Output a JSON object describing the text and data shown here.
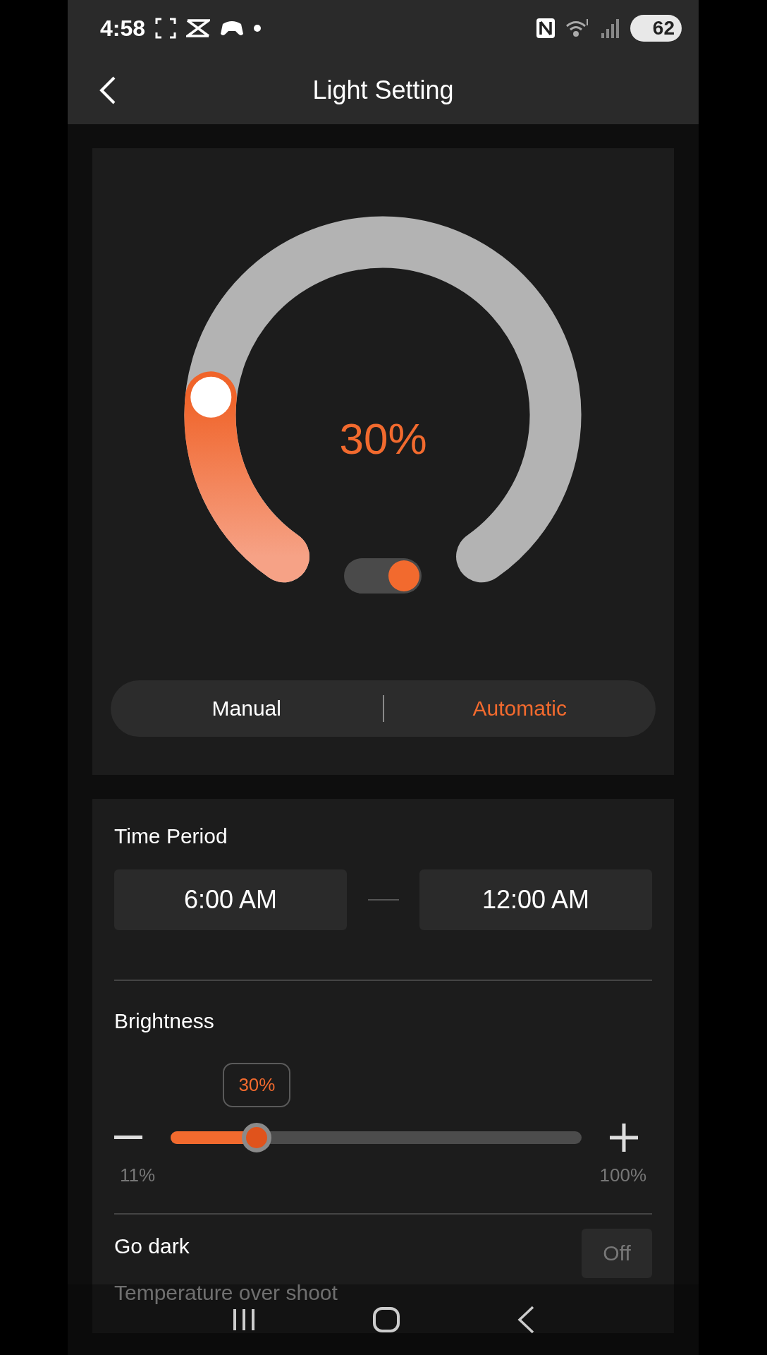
{
  "status_bar": {
    "time": "4:58",
    "battery": "62"
  },
  "header": {
    "title": "Light Setting"
  },
  "dial": {
    "value": "30%",
    "level": 0.21,
    "switch_on": true
  },
  "mode_tabs": [
    {
      "label": "Manual",
      "selected": false
    },
    {
      "label": "Automatic",
      "selected": true
    }
  ],
  "time_period": {
    "label": "Time Period",
    "start": "6:00 AM",
    "end": "12:00 AM"
  },
  "brightness": {
    "label": "Brightness",
    "bubble": "30%",
    "level": 0.21,
    "min": "11%",
    "max": "100%"
  },
  "go_dark": {
    "label": "Go dark",
    "value": "Off"
  },
  "next_setting": {
    "label": "Temperature over shoot"
  }
}
